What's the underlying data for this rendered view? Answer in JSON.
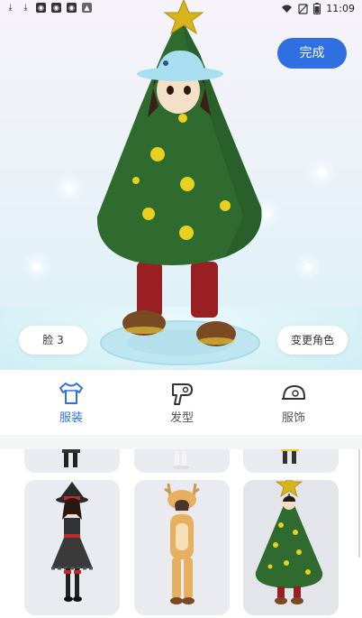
{
  "status_bar": {
    "time": "11:09",
    "left_icons": [
      "download-icon",
      "download-icon",
      "app-icon",
      "app-icon",
      "app-icon",
      "app-icon"
    ],
    "right_icons": [
      "wifi-icon",
      "no-sim-icon",
      "battery-icon"
    ]
  },
  "header": {
    "done_label": "完成"
  },
  "scene": {
    "face_label": "脸 3",
    "change_role_label": "变更角色"
  },
  "tabs": [
    {
      "label": "服装",
      "icon": "shirt-icon",
      "active": true
    },
    {
      "label": "发型",
      "icon": "hair-dryer-icon",
      "active": false
    },
    {
      "label": "服饰",
      "icon": "cap-icon",
      "active": false
    }
  ],
  "outfits": {
    "row1": [
      "outfit-partial-1",
      "outfit-partial-2",
      "outfit-partial-3"
    ],
    "row2": [
      {
        "name": "witch-costume",
        "selected": false
      },
      {
        "name": "reindeer-costume",
        "selected": false
      },
      {
        "name": "christmas-tree-costume",
        "selected": true
      }
    ]
  },
  "colors": {
    "accent": "#2f6fe0",
    "tree_green": "#2f6b2e",
    "ornament_yellow": "#e8d020",
    "star_gold": "#d8b41c",
    "card_bg": "#e9ebf0"
  }
}
